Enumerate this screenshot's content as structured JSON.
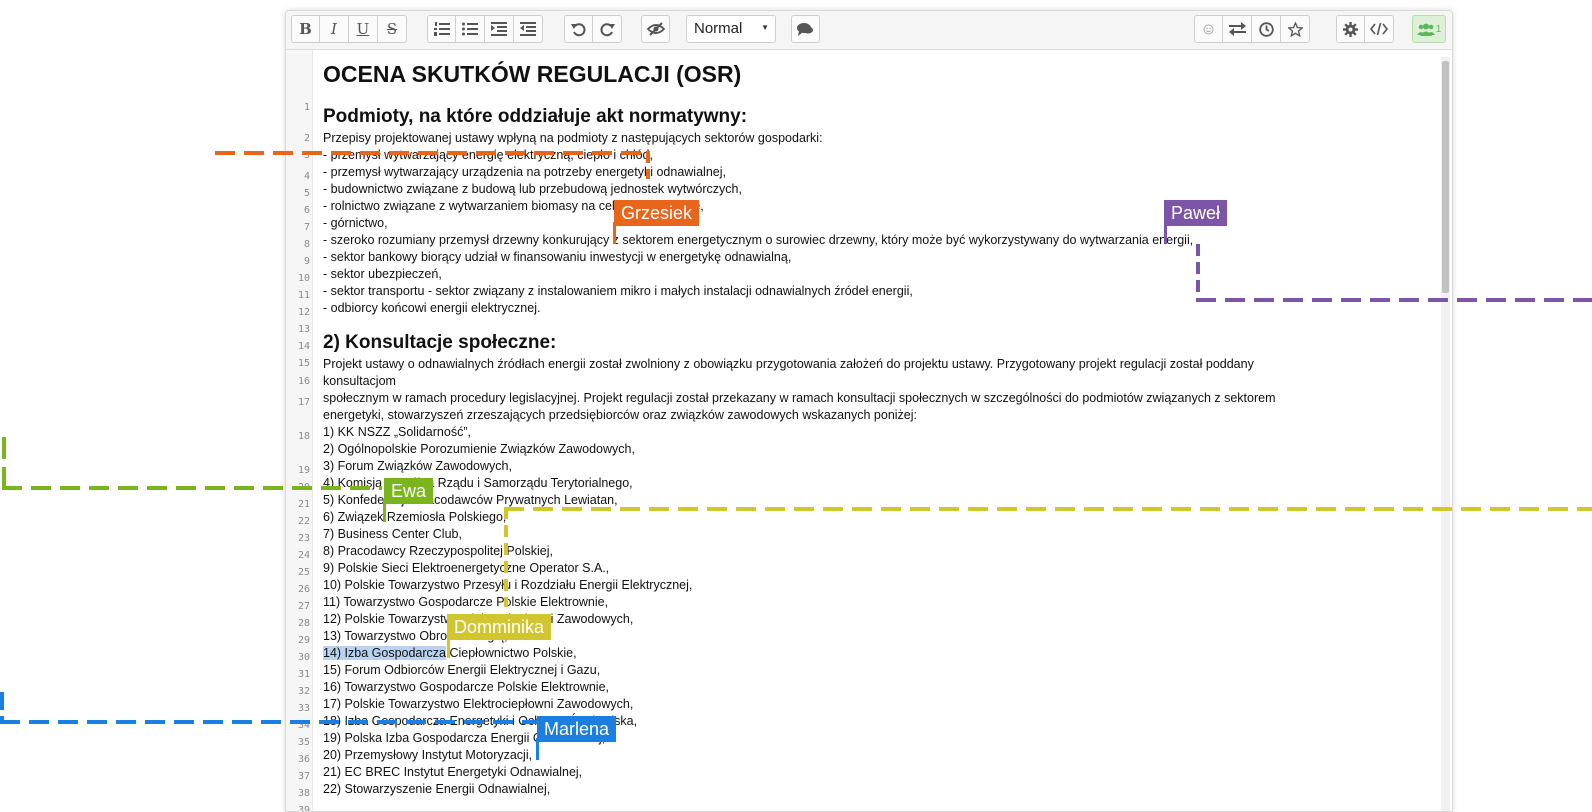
{
  "toolbar": {
    "format_buttons": [
      {
        "icon": "bold-icon",
        "label": "B"
      },
      {
        "icon": "italic-icon",
        "label": "I"
      },
      {
        "icon": "underline-icon",
        "label": "U"
      },
      {
        "icon": "strikethrough-icon",
        "label": "S"
      }
    ],
    "list_buttons": [
      "ordered-list-icon",
      "unordered-list-icon",
      "indent-icon",
      "outdent-icon"
    ],
    "history_buttons": [
      "undo-icon",
      "redo-icon"
    ],
    "style_select_value": "Normal",
    "users_count": "1"
  },
  "document": {
    "lines": [
      {
        "n": "1",
        "text": "OCENA SKUTKÓW REGULACJI (OSR)",
        "style": "h1"
      },
      {
        "n": "2",
        "text": ""
      },
      {
        "n": "3",
        "text": "Podmioty, na które oddziałuje akt normatywny:",
        "style": "h2"
      },
      {
        "n": "4",
        "text": "Przepisy projektowanej ustawy wpłyną na podmioty z następujących sektorów gospodarki:"
      },
      {
        "n": "5",
        "text": " - przemysł wytwarzający energię elektryczną, ciepło i chłód,"
      },
      {
        "n": "6",
        "text": " - przemysł wytwarzający urządzenia na potrzeby energetyki odnawialnej,"
      },
      {
        "n": "7",
        "text": " - budownictwo związane z budową lub przebudową jednostek wytwórczych,"
      },
      {
        "n": "8",
        "text": " - rolnictwo związane z wytwarzaniem biomasy na cele energetyczne,"
      },
      {
        "n": "9",
        "text": "- górnictwo,"
      },
      {
        "n": "10",
        "text": "- szeroko rozumiany przemysł drzewny konkurujący z sektorem energetycznym o surowiec drzewny, który może być wykorzystywany do wytwarzania energii,"
      },
      {
        "n": "11",
        "text": "- sektor bankowy biorący udział w finansowaniu inwestycji w energetykę odnawialną,"
      },
      {
        "n": "12",
        "text": "- sektor ubezpieczeń,"
      },
      {
        "n": "13",
        "text": "- sektor transportu - sektor związany z instalowaniem mikro i małych instalacji odnawialnych źródeł energii,"
      },
      {
        "n": "14",
        "text": "- odbiorcy końcowi energii elektrycznej."
      },
      {
        "n": "15",
        "text": ""
      },
      {
        "n": "16",
        "text": "2) Konsultacje społeczne:",
        "style": "h2"
      },
      {
        "n": "17",
        "text": "Projekt ustawy o odnawialnych źródłach energii został zwolniony z obowiązku przygotowania założeń do projektu ustawy. Przygotowany projekt regulacji został poddany",
        "wrap": "konsultacjom"
      },
      {
        "n": "18",
        "text": "społecznym w ramach procedury legislacyjnej. Projekt regulacji został przekazany w ramach konsultacji społecznych w szczególności do podmiotów związanych z sektorem",
        "wrap": "energetyki, stowarzyszeń zrzeszających przedsiębiorców oraz związków zawodowych wskazanych poniżej:"
      },
      {
        "n": "19",
        "text": "1) KK NSZZ „Solidarność”,"
      },
      {
        "n": "20",
        "text": " 2) Ogólnopolskie Porozumienie Związków Zawodowych,"
      },
      {
        "n": "21",
        "text": "3) Forum Związków Zawodowych,"
      },
      {
        "n": "22",
        "text": "4) Komisja Wspólna Rządu i Samorządu Terytorialnego,"
      },
      {
        "n": "23",
        "text": "5) Konfederacja Pracodawców Prywatnych Lewiatan,"
      },
      {
        "n": "24",
        "text": "6) Związek Rzemiosła Polskiego,"
      },
      {
        "n": "25",
        "text": "7) Business Center Club,"
      },
      {
        "n": "26",
        "text": "8) Pracodawcy Rzeczypospolitej Polskiej,"
      },
      {
        "n": "27",
        "text": "9) Polskie Sieci Elektroenergetyczne Operator S.A.,"
      },
      {
        "n": "28",
        "text": "10) Polskie Towarzystwo Przesyłu i Rozdziału Energii Elektrycznej,"
      },
      {
        "n": "29",
        "text": "11) Towarzystwo Gospodarcze Polskie Elektrownie,"
      },
      {
        "n": "30",
        "text": "12) Polskie Towarzystwo Elektrociepłowni Zawodowych,"
      },
      {
        "n": "31",
        "text": "13) Towarzystwo Obrotu Energią,"
      },
      {
        "n": "32",
        "text": "14) Izba Gospodarcza Ciepłownictwo Polskie,",
        "hl": "14) Izba Gospodarcza",
        "rest": " Ciepłownictwo Polskie,"
      },
      {
        "n": "33",
        "text": "15) Forum Odbiorców Energii Elektrycznej i Gazu,"
      },
      {
        "n": "34",
        "text": "16) Towarzystwo Gospodarcze Polskie Elektrownie,"
      },
      {
        "n": "35",
        "text": "17) Polskie Towarzystwo Elektrociepłowni Zawodowych,"
      },
      {
        "n": "36",
        "text": "18) Izba Gospodarcza Energetyki i Ochrony Środowiska,"
      },
      {
        "n": "37",
        "text": "19) Polska Izba Gospodarcza Energii Odnawialnej,"
      },
      {
        "n": "38",
        "text": "20) Przemysłowy Instytut Motoryzacji,"
      },
      {
        "n": "39",
        "text": "21) EC BREC Instytut Energetyki Odnawialnej,"
      },
      {
        "n": "40",
        "text": "22) Stowarzyszenie Energii Odnawialnej,"
      }
    ]
  },
  "collaborators": [
    {
      "name": "Grzesiek",
      "color": "#e8661c"
    },
    {
      "name": "Paweł",
      "color": "#7d55a6"
    },
    {
      "name": "Ewa",
      "color": "#7ab51d"
    },
    {
      "name": "Domminika",
      "color": "#d1c630"
    },
    {
      "name": "Marlena",
      "color": "#1a7fe0"
    }
  ]
}
